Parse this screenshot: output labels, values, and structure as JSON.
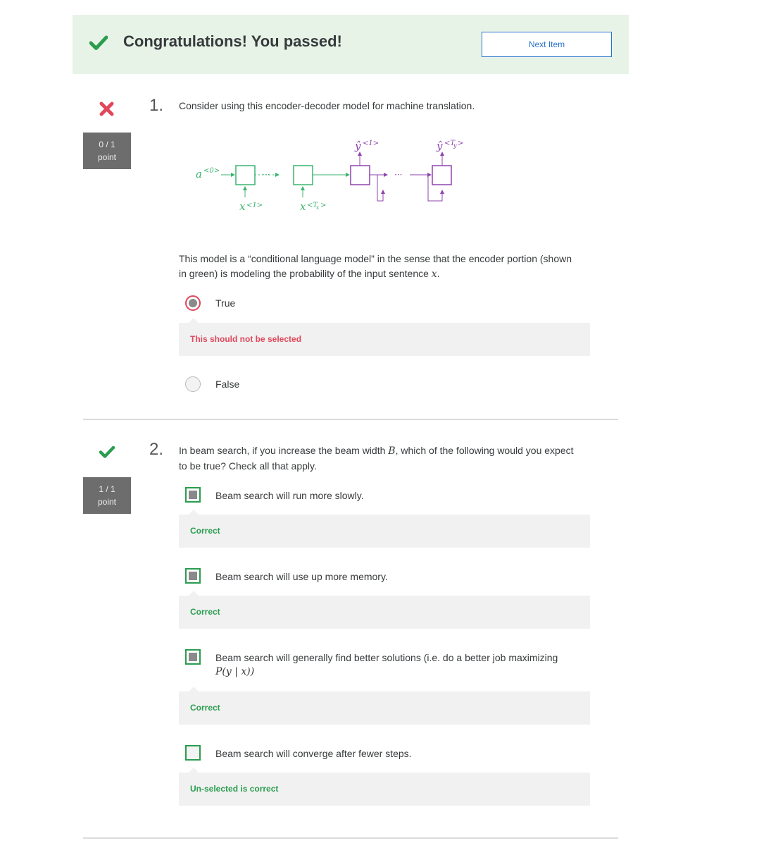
{
  "banner": {
    "title": "Congratulations! You passed!",
    "next_button": "Next Item"
  },
  "questions": [
    {
      "number": "1.",
      "score_line1": "0 / 1",
      "score_line2": "point",
      "status": "incorrect",
      "prompt": "Consider using this encoder-decoder model for machine translation.",
      "diagram": {
        "a0": "a",
        "a0_sup": "<0>",
        "x1": "x",
        "x1_sup": "<1>",
        "xT": "x",
        "xT_sup": "<T",
        "xT_sub": "x",
        "xT_close": ">",
        "y1": "ŷ",
        "y1_sup": "<1>",
        "yT": "ŷ",
        "yT_sup": "<T",
        "yT_sub": "y",
        "yT_close": ">",
        "dots": "···",
        "encoder_color": "#3cb371",
        "decoder_color": "#8e44ad"
      },
      "statement_part1": "This model is a “conditional language model” in the sense that the encoder portion (shown in green) is modeling the probability of the input sentence ",
      "statement_var": "x",
      "statement_end": ".",
      "options": [
        {
          "label": "True",
          "selected": true,
          "feedback": "This should not be selected"
        },
        {
          "label": "False",
          "selected": false
        }
      ]
    },
    {
      "number": "2.",
      "score_line1": "1 / 1",
      "score_line2": "point",
      "status": "correct",
      "prompt_part1": "In beam search, if you increase the beam width ",
      "prompt_var": "B",
      "prompt_part2": ", which of the following would you expect to be true? Check all that apply.",
      "options": [
        {
          "label": "Beam search will run more slowly.",
          "checked": true,
          "feedback": "Correct"
        },
        {
          "label": "Beam search will use up more memory.",
          "checked": true,
          "feedback": "Correct"
        },
        {
          "label": "Beam search will generally find better solutions (i.e. do a better job maximizing",
          "label_math": "P(y | x))",
          "checked": true,
          "feedback": "Correct"
        },
        {
          "label": "Beam search will converge after fewer steps.",
          "checked": false,
          "feedback": "Un-selected is correct"
        }
      ]
    }
  ],
  "colors": {
    "correct": "#2a9d4e",
    "incorrect": "#e0475b",
    "banner_bg": "#e8f3e8",
    "link": "#2a73cc"
  },
  "icons": {
    "pass": "checkmark-icon",
    "fail": "x-mark-icon"
  }
}
